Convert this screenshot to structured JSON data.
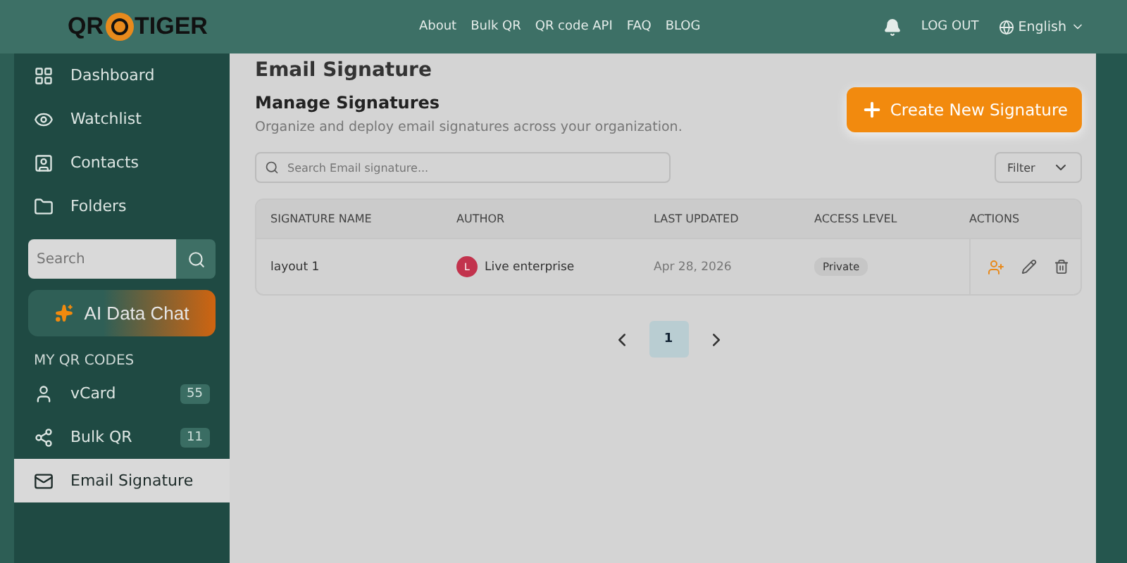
{
  "header": {
    "logo": {
      "left": "QR",
      "right": "TIGER"
    },
    "nav": [
      "About",
      "Bulk QR",
      "QR code API",
      "FAQ",
      "BLOG"
    ],
    "logout": "LOG OUT",
    "language": "English"
  },
  "sidebar": {
    "items": [
      {
        "label": "Dashboard",
        "selected": false
      },
      {
        "label": "Watchlist",
        "selected": false
      },
      {
        "label": "Contacts",
        "selected": false
      },
      {
        "label": "Folders",
        "selected": false
      }
    ],
    "search": {
      "placeholder": "Search"
    },
    "ai_button": "AI Data Chat",
    "section_title": "MY QR CODES",
    "qr_items": [
      {
        "label": "vCard",
        "count": "55",
        "selected": false
      },
      {
        "label": "Bulk QR",
        "count": "11",
        "selected": false
      },
      {
        "label": "Email Signature",
        "selected": true
      }
    ]
  },
  "main": {
    "page_title": "Email Signature",
    "heading": "Manage Signatures",
    "subtitle": "Organize and deploy email signatures across your organization.",
    "create_button": "Create New Signature",
    "search": {
      "placeholder": "Search Email signature..."
    },
    "filter": "Filter",
    "table": {
      "columns": [
        "SIGNATURE NAME",
        "AUTHOR",
        "LAST UPDATED",
        "ACCESS LEVEL",
        "ACTIONS"
      ],
      "rows": [
        {
          "name": "layout 1",
          "author_initial": "L",
          "author": "Live enterprise",
          "updated": "Apr 28, 2026",
          "access": "Private"
        }
      ]
    },
    "pagination": {
      "pages": [
        {
          "label": "1",
          "selected": true
        }
      ]
    }
  }
}
